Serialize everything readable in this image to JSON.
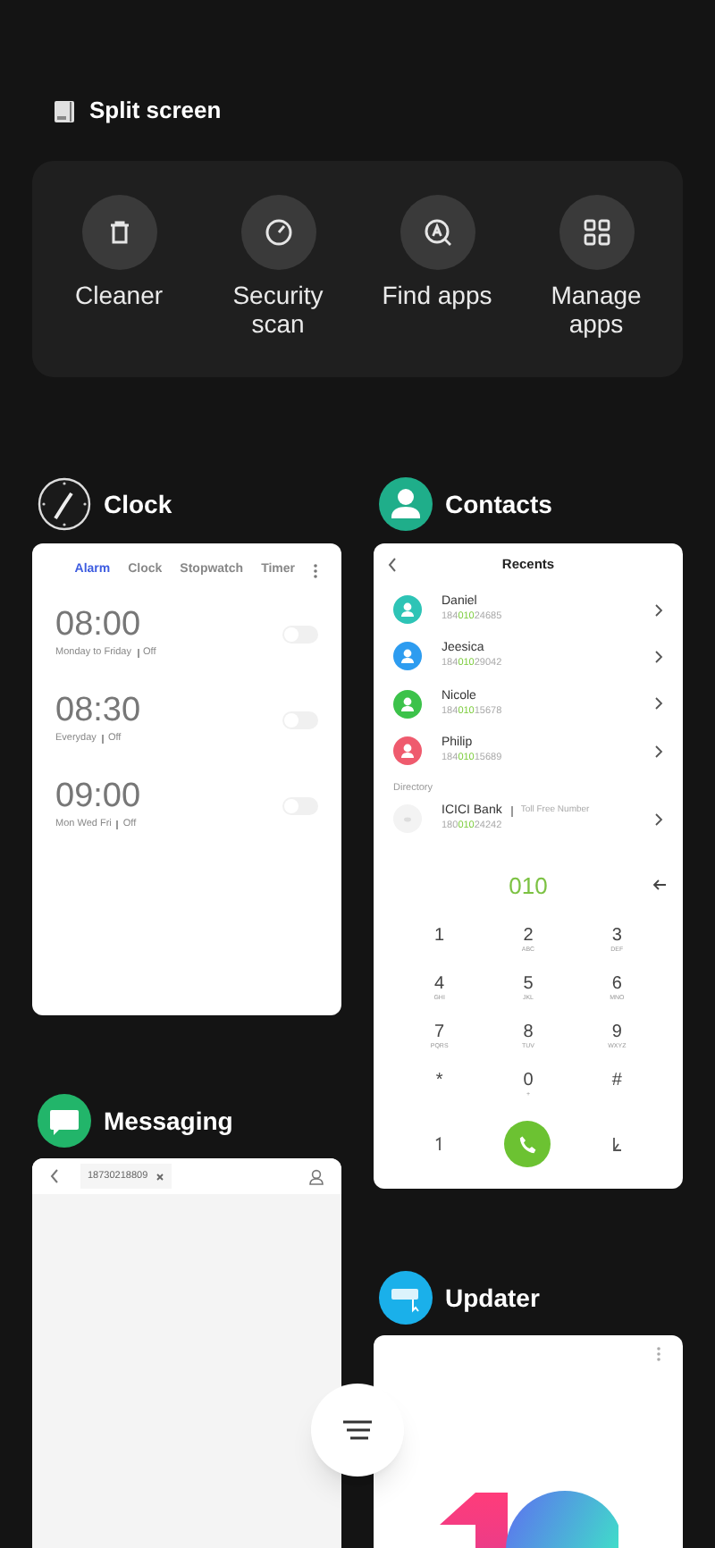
{
  "split_screen": {
    "label": "Split screen"
  },
  "quick_actions": [
    {
      "kind": "cleaner",
      "label": "Cleaner"
    },
    {
      "kind": "security",
      "label": "Security scan"
    },
    {
      "kind": "find",
      "label": "Find apps"
    },
    {
      "kind": "manage",
      "label": "Manage apps"
    }
  ],
  "clock_app": {
    "title": "Clock",
    "tabs": [
      {
        "label": "Alarm",
        "selected": true
      },
      {
        "label": "Clock",
        "selected": false
      },
      {
        "label": "Stopwatch",
        "selected": false
      },
      {
        "label": "Timer",
        "selected": false
      }
    ],
    "alarms": [
      {
        "time": "08:00",
        "repeat": "Monday to Friday",
        "status": "Off",
        "on": false
      },
      {
        "time": "08:30",
        "repeat": "Everyday",
        "status": "Off",
        "on": false
      },
      {
        "time": "09:00",
        "repeat": "Mon Wed Fri",
        "status": "Off",
        "on": false
      }
    ]
  },
  "contacts_app": {
    "title": "Contacts",
    "header": "Recents",
    "recents": [
      {
        "name": "Daniel",
        "number_start": "184",
        "number_match": "010",
        "number_end": "24685",
        "color": "#2ec4b6"
      },
      {
        "name": "Jeesica",
        "number_start": "184",
        "number_match": "010",
        "number_end": "29042",
        "color": "#2d9cf0"
      },
      {
        "name": "Nicole",
        "number_start": "184",
        "number_match": "010",
        "number_end": "15678",
        "color": "#3cc24a"
      },
      {
        "name": "Philip",
        "number_start": "184",
        "number_match": "010",
        "number_end": "15689",
        "color": "#ef5b6e"
      }
    ],
    "directory_label": "Directory",
    "directory": [
      {
        "name": "ICICI Bank",
        "tag": "Toll Free Number",
        "number_start": "180",
        "number_match": "010",
        "number_end": "24242"
      }
    ],
    "dialed": "010",
    "keys": [
      {
        "digit": "1"
      },
      {
        "digit": "2",
        "letters": "ABC"
      },
      {
        "digit": "3",
        "letters": "DEF"
      },
      {
        "digit": "4",
        "letters": "GHI"
      },
      {
        "digit": "5",
        "letters": "JKL"
      },
      {
        "digit": "6",
        "letters": "MNO"
      },
      {
        "digit": "7",
        "letters": "PQRS"
      },
      {
        "digit": "8",
        "letters": "TUV"
      },
      {
        "digit": "9",
        "letters": "WXYZ"
      },
      {
        "digit": "*"
      },
      {
        "digit": "0",
        "letters": "+"
      },
      {
        "digit": "#"
      }
    ]
  },
  "messaging_app": {
    "title": "Messaging",
    "recipient": "18730218809"
  },
  "updater_app": {
    "title": "Updater"
  }
}
